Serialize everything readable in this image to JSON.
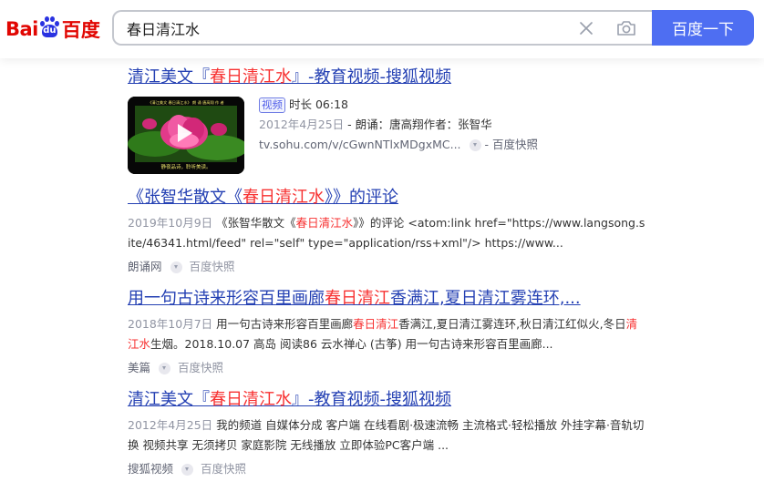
{
  "logo": {
    "bai": "Bai",
    "du": "du",
    "cn": "百度"
  },
  "search": {
    "query": "春日清江水",
    "button_label": "百度一下"
  },
  "results": [
    {
      "title_pre": "清江美文『",
      "title_hl": "春日清江水",
      "title_post": "』-教育视频-搜狐视频",
      "tag": "视频",
      "duration": "时长 06:18",
      "date": "2012年4月25日",
      "meta": " - 朗诵：唐高翔作者：张智华",
      "url": "tv.sohu.com/v/cGwnNTlxMDgxMC...",
      "snapshot": " - 百度快照"
    },
    {
      "title_pre": "《张智华散文《",
      "title_hl": "春日清江水",
      "title_post": "》》的评论",
      "date": "2019年10月9日",
      "abs_pre": " 《张智华散文《",
      "abs_hl": "春日清江水",
      "abs_post": "》》的评论 <atom:link href=\"https://www.langsong.site/46341.html/feed\" rel=\"self\" type=\"application/rss+xml\"/> https://www...",
      "site": "朗诵网",
      "snapshot": "百度快照"
    },
    {
      "title_pre": "用一句古诗来形容百里画廊",
      "title_hl": "春日清江",
      "title_post": "香满江,夏日清江雾连环,...",
      "date": "2018年10月7日",
      "abs_pre": " 用一句古诗来形容百里画廊",
      "abs_hl": "春日清江",
      "abs_mid": "香满江,夏日清江雾连环,秋日清江红似火,冬日",
      "abs_hl2": "清江水",
      "abs_post": "生烟。2018.10.07 高岛 阅读86 云水禅心 (古筝) 用一句古诗来形容百里画廊...",
      "site": "美篇",
      "snapshot": "百度快照"
    },
    {
      "title_pre": "清江美文『",
      "title_hl": "春日清江水",
      "title_post": "』-教育视频-搜狐视频",
      "date": "2012年4月25日",
      "abs_post": " 我的频道 自媒体分成 客户端 在线看剧·极速流畅 主流格式·轻松播放 外挂字幕·音轨切换 视频共享 无须拷贝 家庭影院 无线播放 立即体验PC客户端 ...",
      "site": "搜狐视频",
      "snapshot": "百度快照"
    }
  ],
  "thumbnail": {
    "top_text": "《清江美文 春日清江水》 朗 诵 唐高翔 作 者",
    "bottom_text": "静夜品诗，聆听美读。"
  }
}
